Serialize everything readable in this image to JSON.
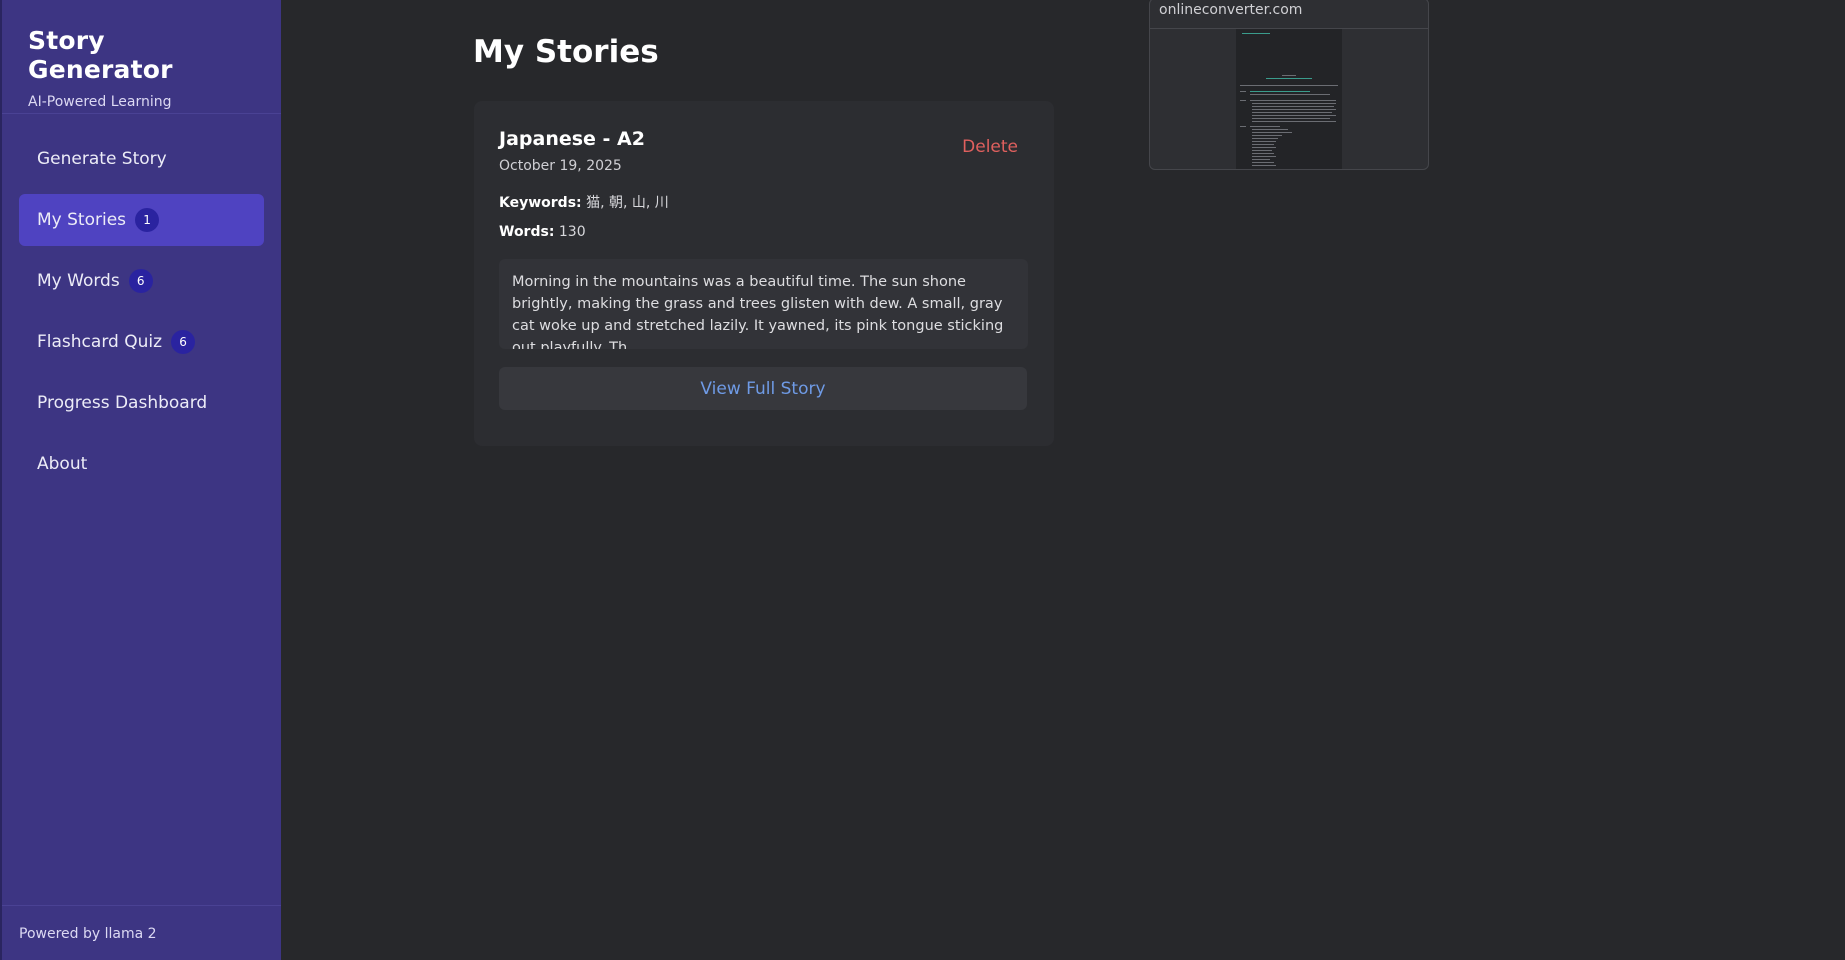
{
  "sidebar": {
    "title": "Story Generator",
    "subtitle": "AI-Powered Learning",
    "items": [
      {
        "label": "Generate Story",
        "badge": null
      },
      {
        "label": "My Stories",
        "badge": "1"
      },
      {
        "label": "My Words",
        "badge": "6"
      },
      {
        "label": "Flashcard Quiz",
        "badge": "6"
      },
      {
        "label": "Progress Dashboard",
        "badge": null
      },
      {
        "label": "About",
        "badge": null
      }
    ],
    "footer": "Powered by llama 2"
  },
  "main": {
    "title": "My Stories",
    "story": {
      "title": "Japanese - A2",
      "date": "October 19, 2025",
      "delete_label": "Delete",
      "keywords_label": "Keywords:",
      "keywords": "猫, 朝, 山, 川",
      "words_label": "Words:",
      "words": "130",
      "excerpt": "Morning in the mountains was a beautiful time. The sun shone brightly, making the grass and trees glisten with dew. A small, gray cat woke up and stretched lazily. It yawned, its pink tongue sticking out playfully. Th…",
      "view_label": "View Full Story"
    }
  },
  "popup": {
    "domain": "onlineconverter.com"
  },
  "colors": {
    "sidebar_bg": "#3d3583",
    "active_item": "#4f43c1",
    "badge": "#2a23a0",
    "delete": "#e0605e",
    "link": "#6f9be6"
  }
}
